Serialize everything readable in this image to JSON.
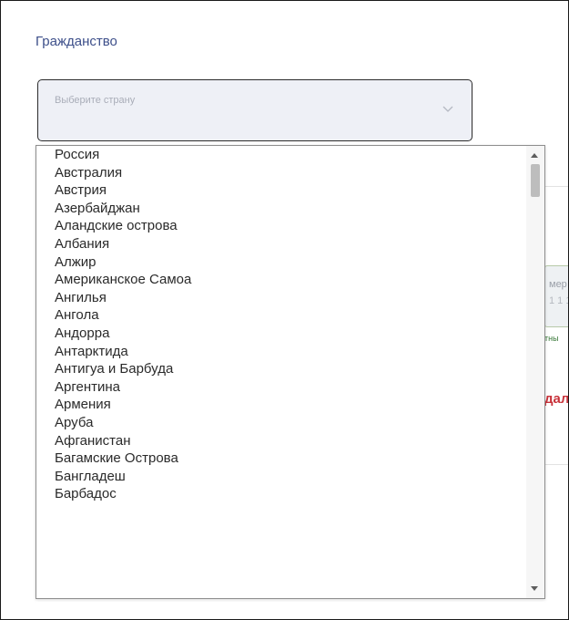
{
  "citizenship": {
    "label": "Гражданство",
    "placeholder": "Выберите страну"
  },
  "background": {
    "field_top_text": "мер",
    "field_bottom_text": "1 1 1",
    "green_hint_text": "тны",
    "red_text": "дал"
  },
  "dropdown": {
    "options": [
      "Россия",
      "Австралия",
      "Австрия",
      "Азербайджан",
      "Аландские острова",
      "Албания",
      "Алжир",
      "Американское Самоа",
      "Ангилья",
      "Ангола",
      "Андорра",
      "Антарктида",
      "Антигуа и Барбуда",
      "Аргентина",
      "Армения",
      "Аруба",
      "Афганистан",
      "Багамские Острова",
      "Бангладеш",
      "Барбадос"
    ]
  },
  "icons": {
    "select_chevron": "chevron-down-icon",
    "scroll_up": "scroll-up-arrow-icon",
    "scroll_down": "scroll-down-arrow-icon"
  },
  "colors": {
    "label": "#3d4f8a",
    "select_background": "#eef0f6",
    "error_red": "#c8323a",
    "hint_green": "#3b7a3b"
  }
}
